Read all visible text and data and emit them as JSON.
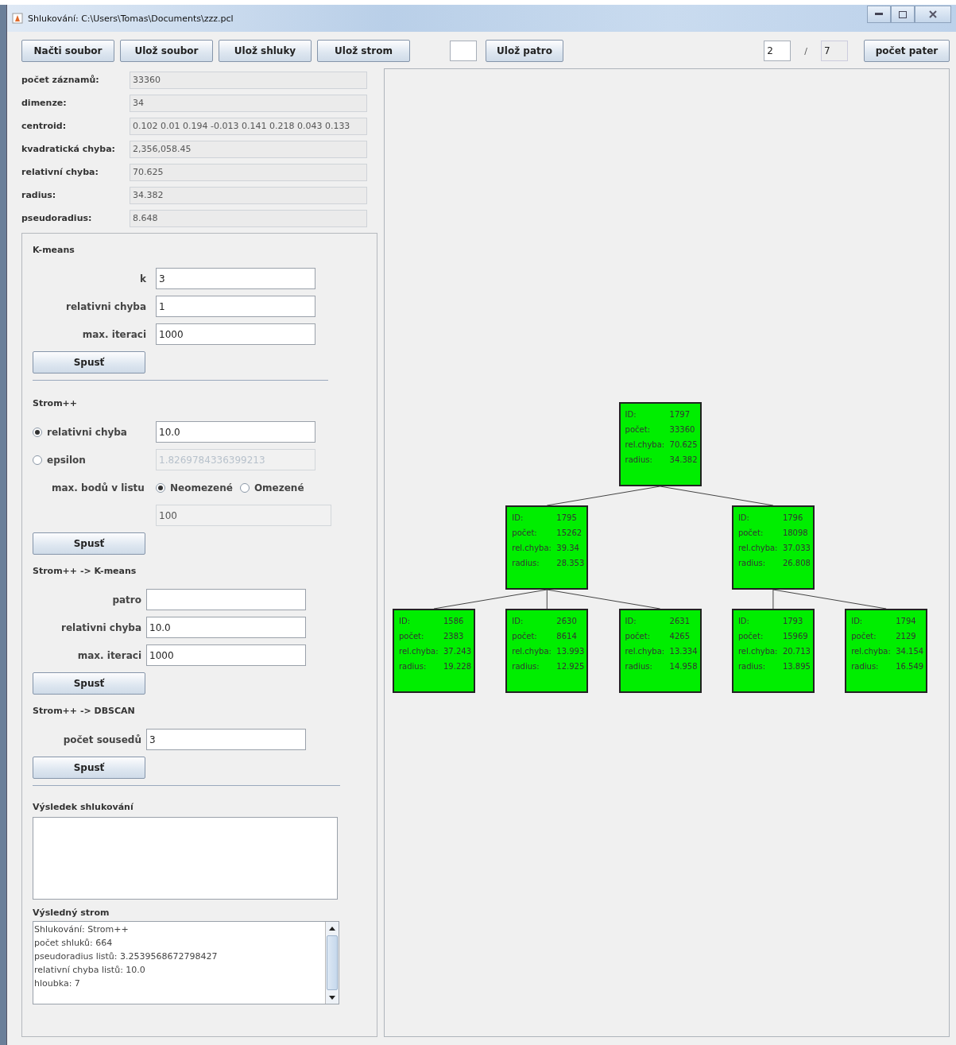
{
  "window": {
    "title": "Shlukování: C:\\Users\\Tomas\\Documents\\zzz.pcl"
  },
  "toolbar": {
    "save_buttons": [
      "Načti soubor",
      "Ulož soubor",
      "Ulož shluky",
      "Ulož strom"
    ],
    "save_level_button": "Ulož patro",
    "level_index": "2",
    "separator": "/",
    "level_count": "7",
    "count_button": "počet pater"
  },
  "stats": [
    {
      "label": "počet záznamů:",
      "value": "33360"
    },
    {
      "label": "dimenze:",
      "value": "34"
    },
    {
      "label": "centroid:",
      "value": "0.102 0.01 0.194 -0.013 0.141 0.218 0.043 0.133"
    },
    {
      "label": "kvadratická chyba:",
      "value": "2,356,058.45"
    },
    {
      "label": "relativní chyba:",
      "value": "70.625"
    },
    {
      "label": "radius:",
      "value": "34.382"
    },
    {
      "label": "pseudoradius:",
      "value": "8.648"
    }
  ],
  "kmeans": {
    "title": "K-means",
    "fields": [
      {
        "label": "k",
        "value": "3"
      },
      {
        "label": "relativni chyba",
        "value": "1"
      },
      {
        "label": "max. iteraci",
        "value": "1000"
      }
    ],
    "run_button": "Spusť"
  },
  "strom": {
    "title": "Strom++",
    "criteria": [
      {
        "label": "relativni chyba",
        "selected": true,
        "value": "10.0"
      },
      {
        "label": "epsilon",
        "selected": false,
        "value": "1.8269784336399213"
      }
    ],
    "max_points": {
      "label": "max. bodů v listu",
      "options": [
        {
          "label": "Neomezené",
          "selected": true
        },
        {
          "label": "Omezené",
          "selected": false
        }
      ],
      "value": "100"
    },
    "run_button": "Spusť"
  },
  "strom_kmeans": {
    "title": "Strom++ -> K-means",
    "fields": [
      {
        "label": "patro"
      },
      {
        "label": "relativni chyba",
        "value": "10.0"
      },
      {
        "label": "max. iteraci",
        "value": "1000"
      }
    ],
    "run_button": "Spusť"
  },
  "strom_dbscan": {
    "title": "Strom++ -> DBSCAN",
    "fields": [
      {
        "label": "počet sousedů",
        "value": "3"
      }
    ],
    "run_button": "Spusť"
  },
  "result": {
    "title": "Výsledek shlukování"
  },
  "tree_output": {
    "title": "Výsledný strom",
    "lines": [
      "Shlukování: Strom++",
      "počet shluků: 664",
      "pseudoradius listů: 3.2539568672798427",
      "relativní chyba listů: 10.0",
      "hloubka: 7"
    ]
  },
  "tree": {
    "rows": [
      {
        "label": "ID:",
        "value": "1797"
      },
      {
        "label": "počet:",
        "value": "33360"
      },
      {
        "label": "rel.chyba:",
        "value": "70.625"
      },
      {
        "label": "radius:",
        "value": "34.382"
      }
    ],
    "children": [
      {
        "rows": [
          {
            "label": "ID:",
            "value": "1795"
          },
          {
            "label": "počet:",
            "value": "15262"
          },
          {
            "label": "rel.chyba:",
            "value": "39.34"
          },
          {
            "label": "radius:",
            "value": "28.353"
          }
        ],
        "children": [
          {
            "rows": [
              {
                "label": "ID:",
                "value": "1586"
              },
              {
                "label": "počet:",
                "value": "2383"
              },
              {
                "label": "rel.chyba:",
                "value": "37.243"
              },
              {
                "label": "radius:",
                "value": "19.228"
              }
            ]
          },
          {
            "rows": [
              {
                "label": "ID:",
                "value": "2630"
              },
              {
                "label": "počet:",
                "value": "8614"
              },
              {
                "label": "rel.chyba:",
                "value": "13.993"
              },
              {
                "label": "radius:",
                "value": "12.925"
              }
            ]
          },
          {
            "rows": [
              {
                "label": "ID:",
                "value": "2631"
              },
              {
                "label": "počet:",
                "value": "4265"
              },
              {
                "label": "rel.chyba:",
                "value": "13.334"
              },
              {
                "label": "radius:",
                "value": "14.958"
              }
            ]
          }
        ]
      },
      {
        "rows": [
          {
            "label": "ID:",
            "value": "1796"
          },
          {
            "label": "počet:",
            "value": "18098"
          },
          {
            "label": "rel.chyba:",
            "value": "37.033"
          },
          {
            "label": "radius:",
            "value": "26.808"
          }
        ],
        "children": [
          {
            "rows": [
              {
                "label": "ID:",
                "value": "1793"
              },
              {
                "label": "počet:",
                "value": "15969"
              },
              {
                "label": "rel.chyba:",
                "value": "20.713"
              },
              {
                "label": "radius:",
                "value": "13.895"
              }
            ]
          },
          {
            "rows": [
              {
                "label": "ID:",
                "value": "1794"
              },
              {
                "label": "počet:",
                "value": "2129"
              },
              {
                "label": "rel.chyba:",
                "value": "34.154"
              },
              {
                "label": "radius:",
                "value": "16.549"
              }
            ]
          }
        ]
      }
    ]
  }
}
